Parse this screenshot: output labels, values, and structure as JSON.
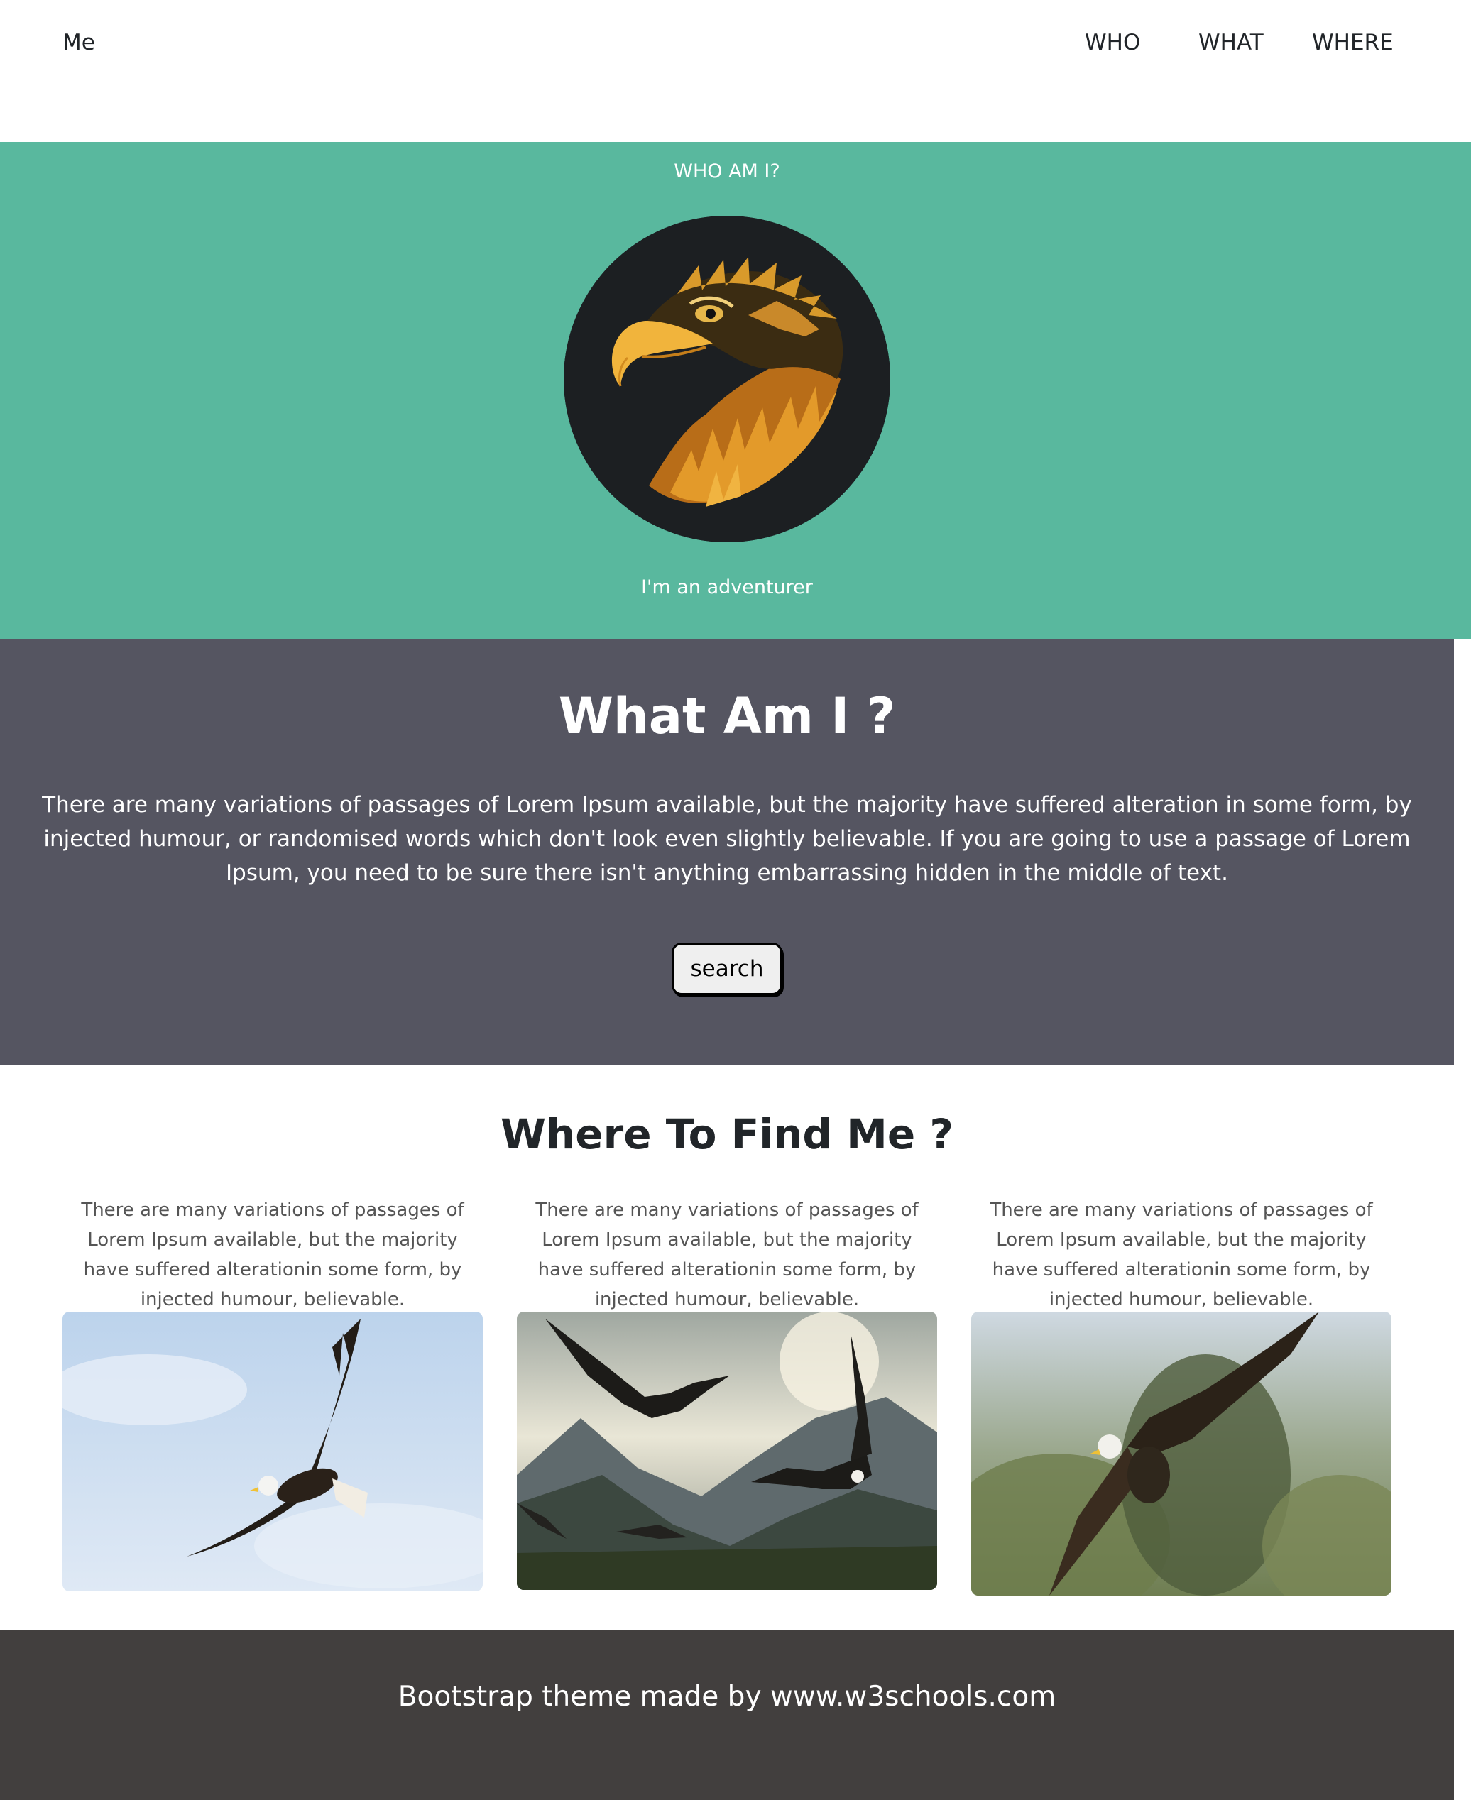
{
  "navbar": {
    "brand": "Me",
    "links": [
      "WHO",
      "WHAT",
      "WHERE"
    ]
  },
  "who": {
    "heading": "WHO AM I?",
    "tagline": "I'm an adventurer"
  },
  "what": {
    "title": "What Am I ?",
    "text": "There are many variations of passages of Lorem Ipsum available, but the majority have suffered alteration in some form, by injected humour, or randomised words which don't look even slightly believable. If you are going to use a passage of Lorem Ipsum, you need to be sure there isn't anything embarrassing hidden in the middle of text.",
    "button_label": "search"
  },
  "where": {
    "title": "Where To Find Me ?",
    "cards": [
      {
        "text": "There are many variations of passages of Lorem Ipsum available, but the majority have suffered alterationin some form, by injected humour, believable."
      },
      {
        "text": "There are many variations of passages of Lorem Ipsum available, but the majority have suffered alterationin some form, by injected humour, believable."
      },
      {
        "text": "There are many variations of passages of Lorem Ipsum available, but the majority have suffered alterationin some form, by injected humour, believable."
      }
    ]
  },
  "footer": {
    "text": "Bootstrap theme made by www.w3schools.com"
  },
  "colors": {
    "who_bg": "#59b89e",
    "what_bg": "#555561",
    "footer_bg": "#423f3e"
  }
}
